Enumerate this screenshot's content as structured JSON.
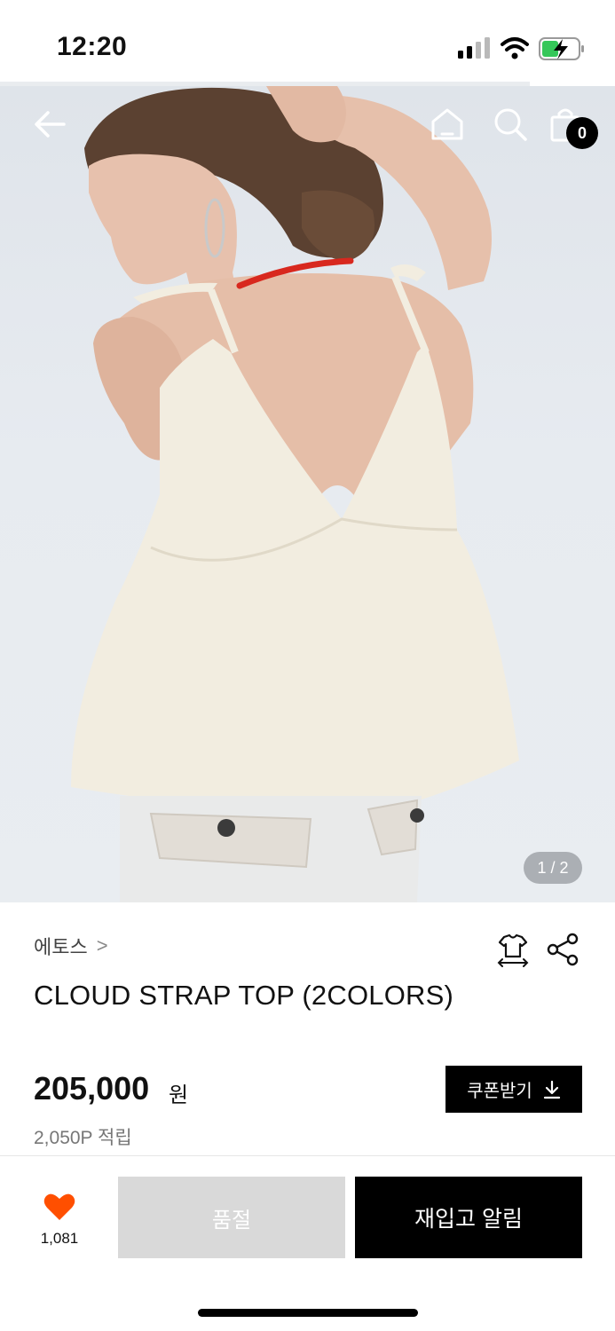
{
  "status_bar": {
    "time": "12:20"
  },
  "gallery": {
    "indicator": "1 / 2"
  },
  "header": {
    "cart_count": "0"
  },
  "product": {
    "brand": "에토스",
    "brand_chevron": ">",
    "title": "CLOUD STRAP TOP (2COLORS)",
    "price": "205,000",
    "currency": "원",
    "points": "2,050P 적립"
  },
  "coupon": {
    "label": "쿠폰받기"
  },
  "bottom_bar": {
    "like_count": "1,081",
    "soldout_label": "품절",
    "restock_label": "재입고 알림"
  },
  "colors": {
    "accent_heart": "#ff4f00",
    "button_dark": "#000000",
    "button_disabled": "#d9d9d9"
  },
  "icons": [
    "back-arrow-icon",
    "home-icon",
    "search-icon",
    "shopping-bag-icon",
    "size-fit-icon",
    "share-icon",
    "heart-icon",
    "download-icon"
  ]
}
